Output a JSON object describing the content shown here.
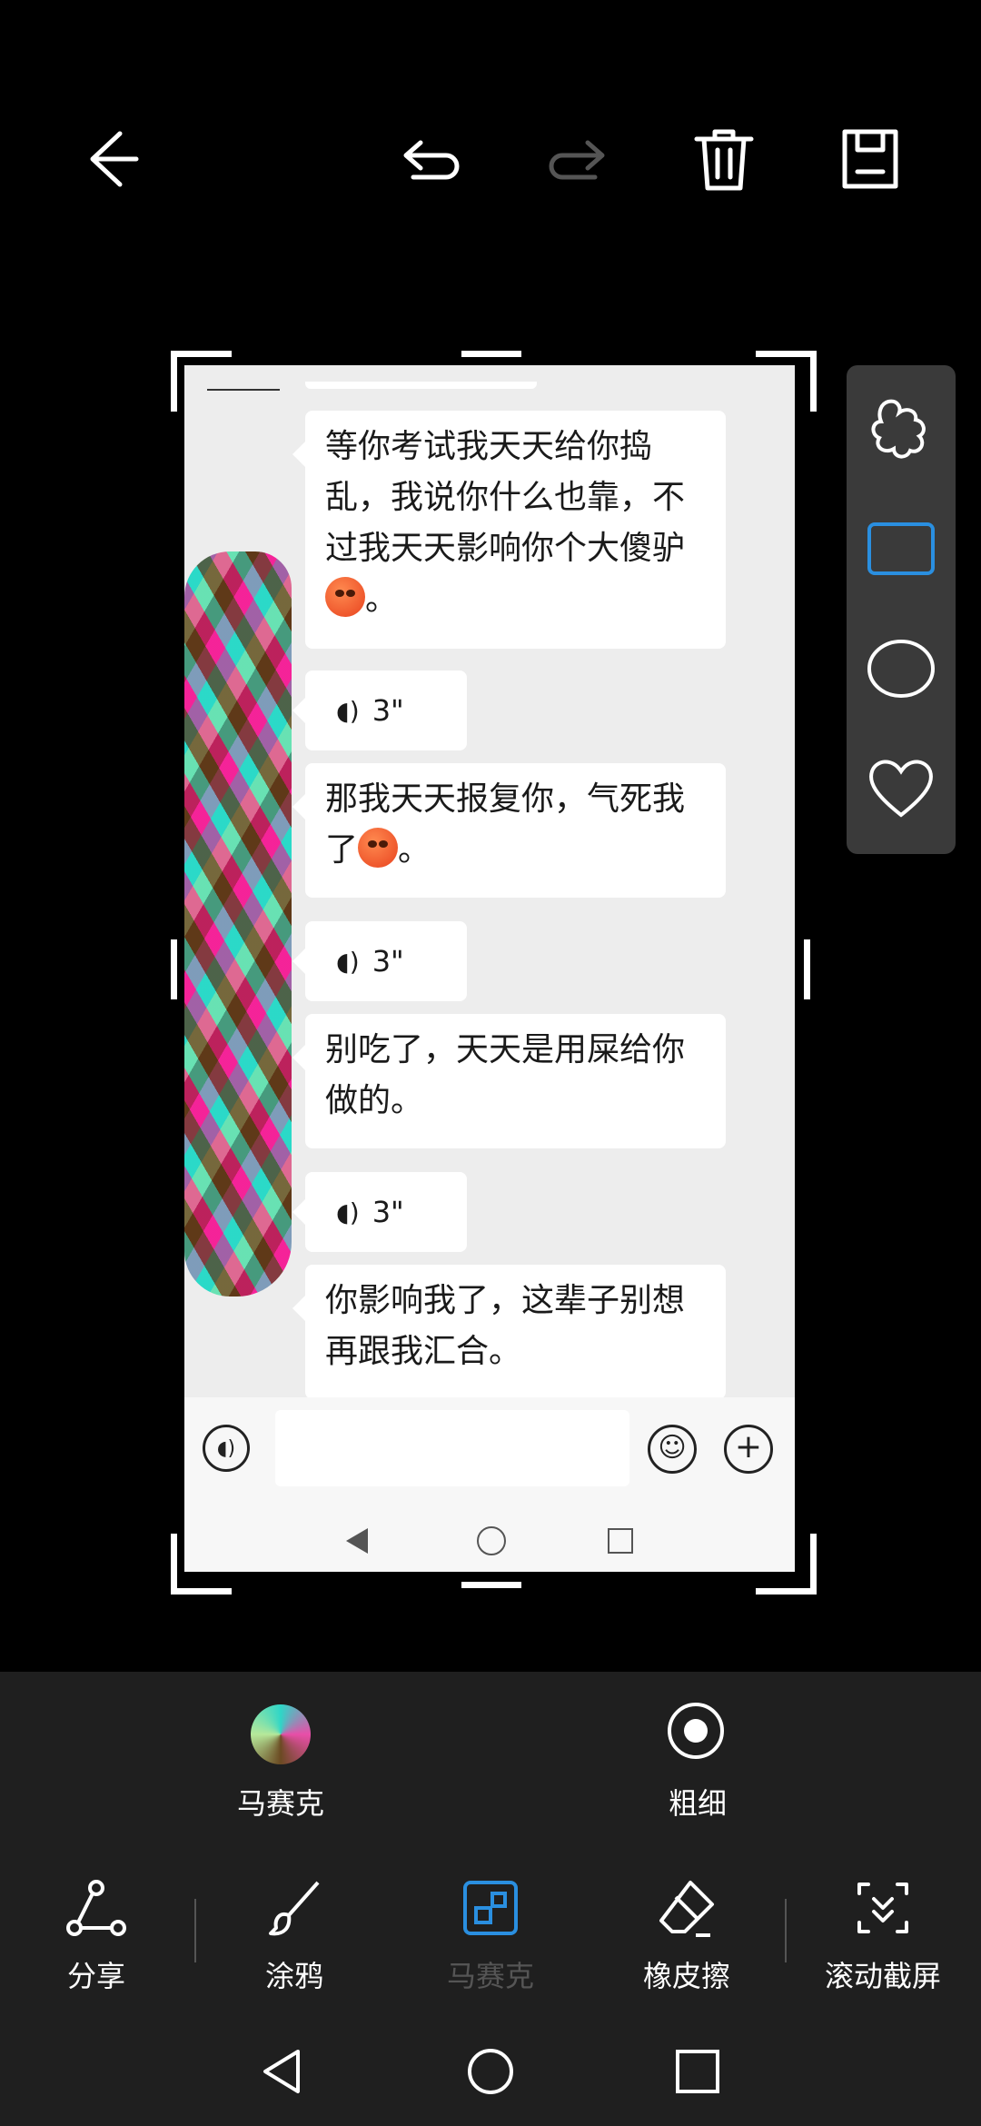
{
  "toolbar": {
    "back_icon": "arrow-left-icon",
    "undo_icon": "undo-icon",
    "redo_icon": "redo-icon",
    "delete_icon": "trash-icon",
    "save_icon": "save-icon"
  },
  "chat": {
    "messages": [
      {
        "type": "text",
        "text": "等你考试我天天给你捣乱，我说你什么也靠，不过我天天影响你个大傻驴",
        "suffix": "。",
        "emoji": "angry-face"
      },
      {
        "type": "voice",
        "duration": "3\""
      },
      {
        "type": "text",
        "text": "那我天天报复你，气死我了",
        "suffix": "。",
        "emoji": "angry-face"
      },
      {
        "type": "voice",
        "duration": "3\""
      },
      {
        "type": "text",
        "text": "别吃了，天天是用屎给你做的。"
      },
      {
        "type": "voice",
        "duration": "3\""
      },
      {
        "type": "text",
        "text": "你影响我了，这辈子别想再跟我汇合。"
      }
    ],
    "input_placeholder": ""
  },
  "shapes": [
    "puzzle-icon",
    "rectangle-icon",
    "circle-icon",
    "heart-icon"
  ],
  "selected_shape": "rectangle-icon",
  "options": {
    "mosaic_label": "马赛克",
    "thickness_label": "粗细"
  },
  "tools": {
    "share_label": "分享",
    "doodle_label": "涂鸦",
    "mosaic_label": "马赛克",
    "eraser_label": "橡皮擦",
    "scroll_label": "滚动截屏"
  },
  "colors": {
    "accent": "#2a8fe0",
    "panel": "#1f1f1f",
    "disabled": "#555555"
  }
}
